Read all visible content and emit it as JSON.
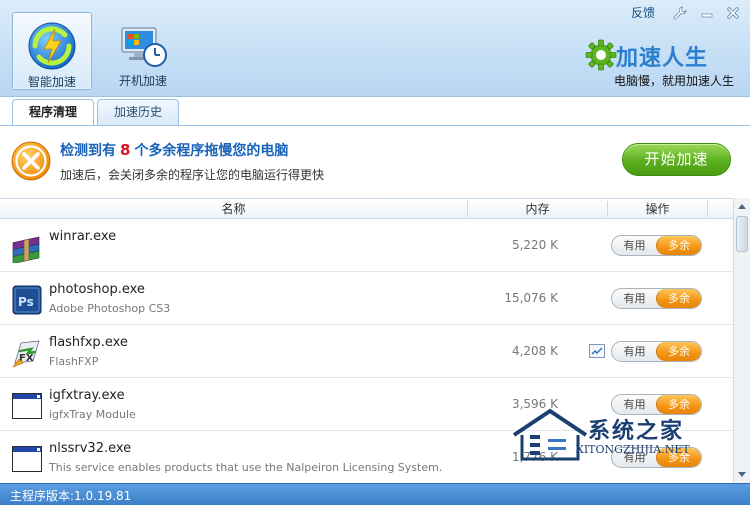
{
  "window": {
    "feedback_label": "反馈",
    "settings_icon": "wrench-icon",
    "minimize_icon": "minimize-icon",
    "close_icon": "close-icon"
  },
  "toolbar": {
    "items": [
      {
        "label": "智能加速",
        "icon": "smart-accelerate-icon",
        "active": true
      },
      {
        "label": "开机加速",
        "icon": "boot-accelerate-icon",
        "active": false
      }
    ]
  },
  "brand": {
    "name": "加速人生",
    "slogan": "电脑慢，就用加速人生",
    "icon": "gear-logo-icon"
  },
  "tabs": [
    {
      "label": "程序清理",
      "active": true
    },
    {
      "label": "加速历史",
      "active": false
    }
  ],
  "banner": {
    "headline_prefix": "检测到有",
    "count": "8",
    "headline_suffix": "个多余程序拖慢您的电脑",
    "subline": "加速后，会关闭多余的程序让您的电脑运行得更快",
    "start_button": "开始加速"
  },
  "columns": {
    "name": "名称",
    "memory": "内存",
    "action": "操作"
  },
  "rows": [
    {
      "name": "winrar.exe",
      "desc": "",
      "memory": "5,220 K",
      "icon": "winrar-icon",
      "toggle_yes": "有用",
      "toggle_no": "多余",
      "checkbox": false
    },
    {
      "name": "photoshop.exe",
      "desc": "Adobe Photoshop CS3",
      "memory": "15,076 K",
      "icon": "photoshop-icon",
      "toggle_yes": "有用",
      "toggle_no": "多余",
      "checkbox": false
    },
    {
      "name": "flashfxp.exe",
      "desc": "FlashFXP",
      "memory": "4,208 K",
      "icon": "flashfxp-icon",
      "toggle_yes": "有用",
      "toggle_no": "多余",
      "checkbox": true
    },
    {
      "name": "igfxtray.exe",
      "desc": "igfxTray Module",
      "memory": "3,596 K",
      "icon": "window-app-icon",
      "toggle_yes": "有用",
      "toggle_no": "多余",
      "checkbox": false
    },
    {
      "name": "nlssrv32.exe",
      "desc": "This service enables products that use the Nalpeiron Licensing System.",
      "memory": "1,776 K",
      "icon": "window-app-icon",
      "toggle_yes": "有用",
      "toggle_no": "多余",
      "checkbox": false
    }
  ],
  "watermark": {
    "title": "系统之家",
    "url": "XITONGZHIJIA.NET"
  },
  "status": {
    "version": "主程序版本:1.0.19.81"
  }
}
